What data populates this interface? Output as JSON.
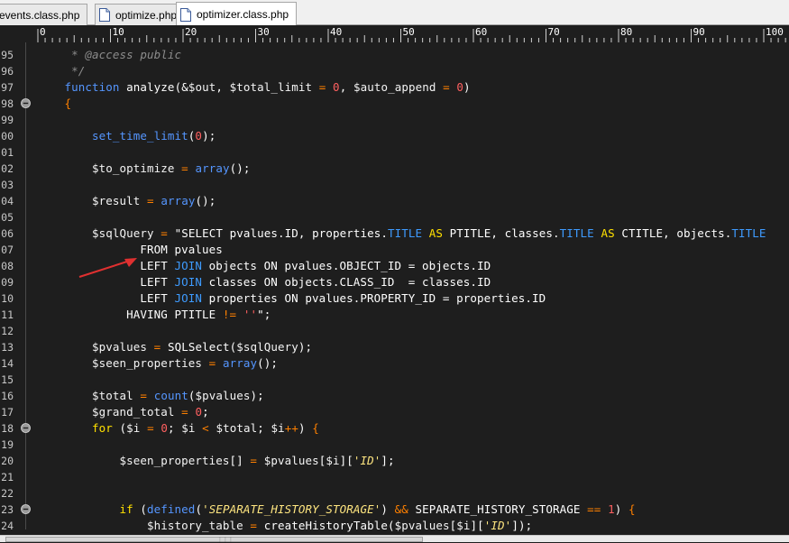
{
  "tabs": [
    {
      "label": "events.class.php",
      "active": false
    },
    {
      "label": "optimize.php",
      "active": false
    },
    {
      "label": "optimizer.class.php",
      "active": true
    }
  ],
  "ruler": {
    "labels": [
      "0",
      "10",
      "20",
      "30",
      "40",
      "50",
      "60",
      "70",
      "80",
      "90",
      "100"
    ]
  },
  "editor": {
    "lines": [
      {
        "num": "95",
        "tokens": [
          [
            "c",
            "     * @access public"
          ]
        ]
      },
      {
        "num": "96",
        "tokens": [
          [
            "c",
            "     */"
          ]
        ]
      },
      {
        "num": "97",
        "tokens": [
          [
            "p",
            "    "
          ],
          [
            "k",
            "function"
          ],
          [
            "p",
            " "
          ],
          [
            "f",
            "analyze"
          ],
          [
            "p",
            "(&"
          ],
          [
            "v",
            "$out"
          ],
          [
            "p",
            ", "
          ],
          [
            "v",
            "$total_limit"
          ],
          [
            "p",
            " "
          ],
          [
            "o",
            "="
          ],
          [
            "p",
            " "
          ],
          [
            "n",
            "0"
          ],
          [
            "p",
            ", "
          ],
          [
            "v",
            "$auto_append"
          ],
          [
            "p",
            " "
          ],
          [
            "o",
            "="
          ],
          [
            "p",
            " "
          ],
          [
            "n",
            "0"
          ],
          [
            "p",
            ")"
          ]
        ]
      },
      {
        "num": "98",
        "tokens": [
          [
            "o",
            "    {"
          ]
        ]
      },
      {
        "num": "99",
        "tokens": []
      },
      {
        "num": "00",
        "tokens": [
          [
            "p",
            "        "
          ],
          [
            "k",
            "set_time_limit"
          ],
          [
            "p",
            "("
          ],
          [
            "n",
            "0"
          ],
          [
            "p",
            ");"
          ]
        ]
      },
      {
        "num": "01",
        "tokens": []
      },
      {
        "num": "02",
        "tokens": [
          [
            "p",
            "        "
          ],
          [
            "v",
            "$to_optimize"
          ],
          [
            "p",
            " "
          ],
          [
            "o",
            "="
          ],
          [
            "p",
            " "
          ],
          [
            "k",
            "array"
          ],
          [
            "p",
            "();"
          ]
        ]
      },
      {
        "num": "03",
        "tokens": []
      },
      {
        "num": "04",
        "tokens": [
          [
            "p",
            "        "
          ],
          [
            "v",
            "$result"
          ],
          [
            "p",
            " "
          ],
          [
            "o",
            "="
          ],
          [
            "p",
            " "
          ],
          [
            "k",
            "array"
          ],
          [
            "p",
            "();"
          ]
        ]
      },
      {
        "num": "05",
        "tokens": []
      },
      {
        "num": "06",
        "tokens": [
          [
            "p",
            "        "
          ],
          [
            "v",
            "$sqlQuery"
          ],
          [
            "p",
            " "
          ],
          [
            "o",
            "="
          ],
          [
            "p",
            " "
          ],
          [
            "s",
            "\"SELECT pvalues.ID, properties."
          ],
          [
            "sk",
            "TITLE"
          ],
          [
            "p",
            " "
          ],
          [
            "sy",
            "AS"
          ],
          [
            "s",
            " PTITLE, classes."
          ],
          [
            "sk",
            "TITLE"
          ],
          [
            "p",
            " "
          ],
          [
            "sy",
            "AS"
          ],
          [
            "s",
            " CTITLE, objects."
          ],
          [
            "sk",
            "TITLE"
          ]
        ]
      },
      {
        "num": "07",
        "tokens": [
          [
            "s",
            "               FROM pvalues"
          ]
        ]
      },
      {
        "num": "08",
        "tokens": [
          [
            "s",
            "               LEFT "
          ],
          [
            "sk",
            "JOIN"
          ],
          [
            "s",
            " objects ON pvalues.OBJECT_ID = objects.ID"
          ]
        ]
      },
      {
        "num": "09",
        "tokens": [
          [
            "s",
            "               LEFT "
          ],
          [
            "sk",
            "JOIN"
          ],
          [
            "s",
            " classes ON objects.CLASS_ID  = classes.ID"
          ]
        ]
      },
      {
        "num": "10",
        "tokens": [
          [
            "s",
            "               LEFT "
          ],
          [
            "sk",
            "JOIN"
          ],
          [
            "s",
            " properties ON pvalues.PROPERTY_ID = properties.ID"
          ]
        ]
      },
      {
        "num": "11",
        "tokens": [
          [
            "s",
            "             HAVING PTITLE "
          ],
          [
            "o",
            "!="
          ],
          [
            "s",
            " "
          ],
          [
            "n",
            "''"
          ],
          [
            "s",
            "\";"
          ]
        ]
      },
      {
        "num": "12",
        "tokens": []
      },
      {
        "num": "13",
        "tokens": [
          [
            "p",
            "        "
          ],
          [
            "v",
            "$pvalues"
          ],
          [
            "p",
            " "
          ],
          [
            "o",
            "="
          ],
          [
            "p",
            " "
          ],
          [
            "f",
            "SQLSelect"
          ],
          [
            "p",
            "("
          ],
          [
            "v",
            "$sqlQuery"
          ],
          [
            "p",
            ");"
          ]
        ]
      },
      {
        "num": "14",
        "tokens": [
          [
            "p",
            "        "
          ],
          [
            "v",
            "$seen_properties"
          ],
          [
            "p",
            " "
          ],
          [
            "o",
            "="
          ],
          [
            "p",
            " "
          ],
          [
            "k",
            "array"
          ],
          [
            "p",
            "();"
          ]
        ]
      },
      {
        "num": "15",
        "tokens": []
      },
      {
        "num": "16",
        "tokens": [
          [
            "p",
            "        "
          ],
          [
            "v",
            "$total"
          ],
          [
            "p",
            " "
          ],
          [
            "o",
            "="
          ],
          [
            "p",
            " "
          ],
          [
            "k",
            "count"
          ],
          [
            "p",
            "("
          ],
          [
            "v",
            "$pvalues"
          ],
          [
            "p",
            ");"
          ]
        ]
      },
      {
        "num": "17",
        "tokens": [
          [
            "p",
            "        "
          ],
          [
            "v",
            "$grand_total"
          ],
          [
            "p",
            " "
          ],
          [
            "o",
            "="
          ],
          [
            "p",
            " "
          ],
          [
            "n",
            "0"
          ],
          [
            "p",
            ";"
          ]
        ]
      },
      {
        "num": "18",
        "tokens": [
          [
            "p",
            "        "
          ],
          [
            "sy",
            "for"
          ],
          [
            "p",
            " ("
          ],
          [
            "v",
            "$i"
          ],
          [
            "p",
            " "
          ],
          [
            "o",
            "="
          ],
          [
            "p",
            " "
          ],
          [
            "n",
            "0"
          ],
          [
            "p",
            "; "
          ],
          [
            "v",
            "$i"
          ],
          [
            "p",
            " "
          ],
          [
            "o",
            "<"
          ],
          [
            "p",
            " "
          ],
          [
            "v",
            "$total"
          ],
          [
            "p",
            "; "
          ],
          [
            "v",
            "$i"
          ],
          [
            "o",
            "++"
          ],
          [
            "p",
            ") "
          ],
          [
            "o",
            "{"
          ]
        ]
      },
      {
        "num": "19",
        "tokens": []
      },
      {
        "num": "20",
        "tokens": [
          [
            "p",
            "            "
          ],
          [
            "v",
            "$seen_properties"
          ],
          [
            "p",
            "[] "
          ],
          [
            "o",
            "="
          ],
          [
            "p",
            " "
          ],
          [
            "v",
            "$pvalues"
          ],
          [
            "p",
            "["
          ],
          [
            "v",
            "$i"
          ],
          [
            "p",
            "]["
          ],
          [
            "i",
            "'ID'"
          ],
          [
            "p",
            "];"
          ]
        ]
      },
      {
        "num": "21",
        "tokens": []
      },
      {
        "num": "22",
        "tokens": []
      },
      {
        "num": "23",
        "tokens": [
          [
            "p",
            "            "
          ],
          [
            "sy",
            "if"
          ],
          [
            "p",
            " ("
          ],
          [
            "k",
            "defined"
          ],
          [
            "p",
            "("
          ],
          [
            "i",
            "'SEPARATE_HISTORY_STORAGE'"
          ],
          [
            "p",
            ") "
          ],
          [
            "o",
            "&&"
          ],
          [
            "p",
            " SEPARATE_HISTORY_STORAGE "
          ],
          [
            "o",
            "=="
          ],
          [
            "p",
            " "
          ],
          [
            "n",
            "1"
          ],
          [
            "p",
            ") "
          ],
          [
            "o",
            "{"
          ]
        ]
      },
      {
        "num": "24",
        "tokens": [
          [
            "p",
            "                "
          ],
          [
            "v",
            "$history_table"
          ],
          [
            "p",
            " "
          ],
          [
            "o",
            "="
          ],
          [
            "p",
            " "
          ],
          [
            "f",
            "createHistoryTable"
          ],
          [
            "p",
            "("
          ],
          [
            "v",
            "$pvalues"
          ],
          [
            "p",
            "["
          ],
          [
            "v",
            "$i"
          ],
          [
            "p",
            "]["
          ],
          [
            "i",
            "'ID'"
          ],
          [
            "p",
            "]);"
          ]
        ]
      }
    ]
  },
  "folds": [
    "98",
    "18",
    "23"
  ],
  "colors": {
    "background": "#1e1e1e",
    "keyword": "#5596ff",
    "number": "#ff6060",
    "operator": "#ff8000",
    "string_keyword": "#3e9bff",
    "control": "#ffe000",
    "annotation_arrow": "#e03030"
  },
  "icons": {
    "tab": "php-file-icon",
    "fold": "fold-minus-icon",
    "annotation": "red-arrow-icon"
  }
}
